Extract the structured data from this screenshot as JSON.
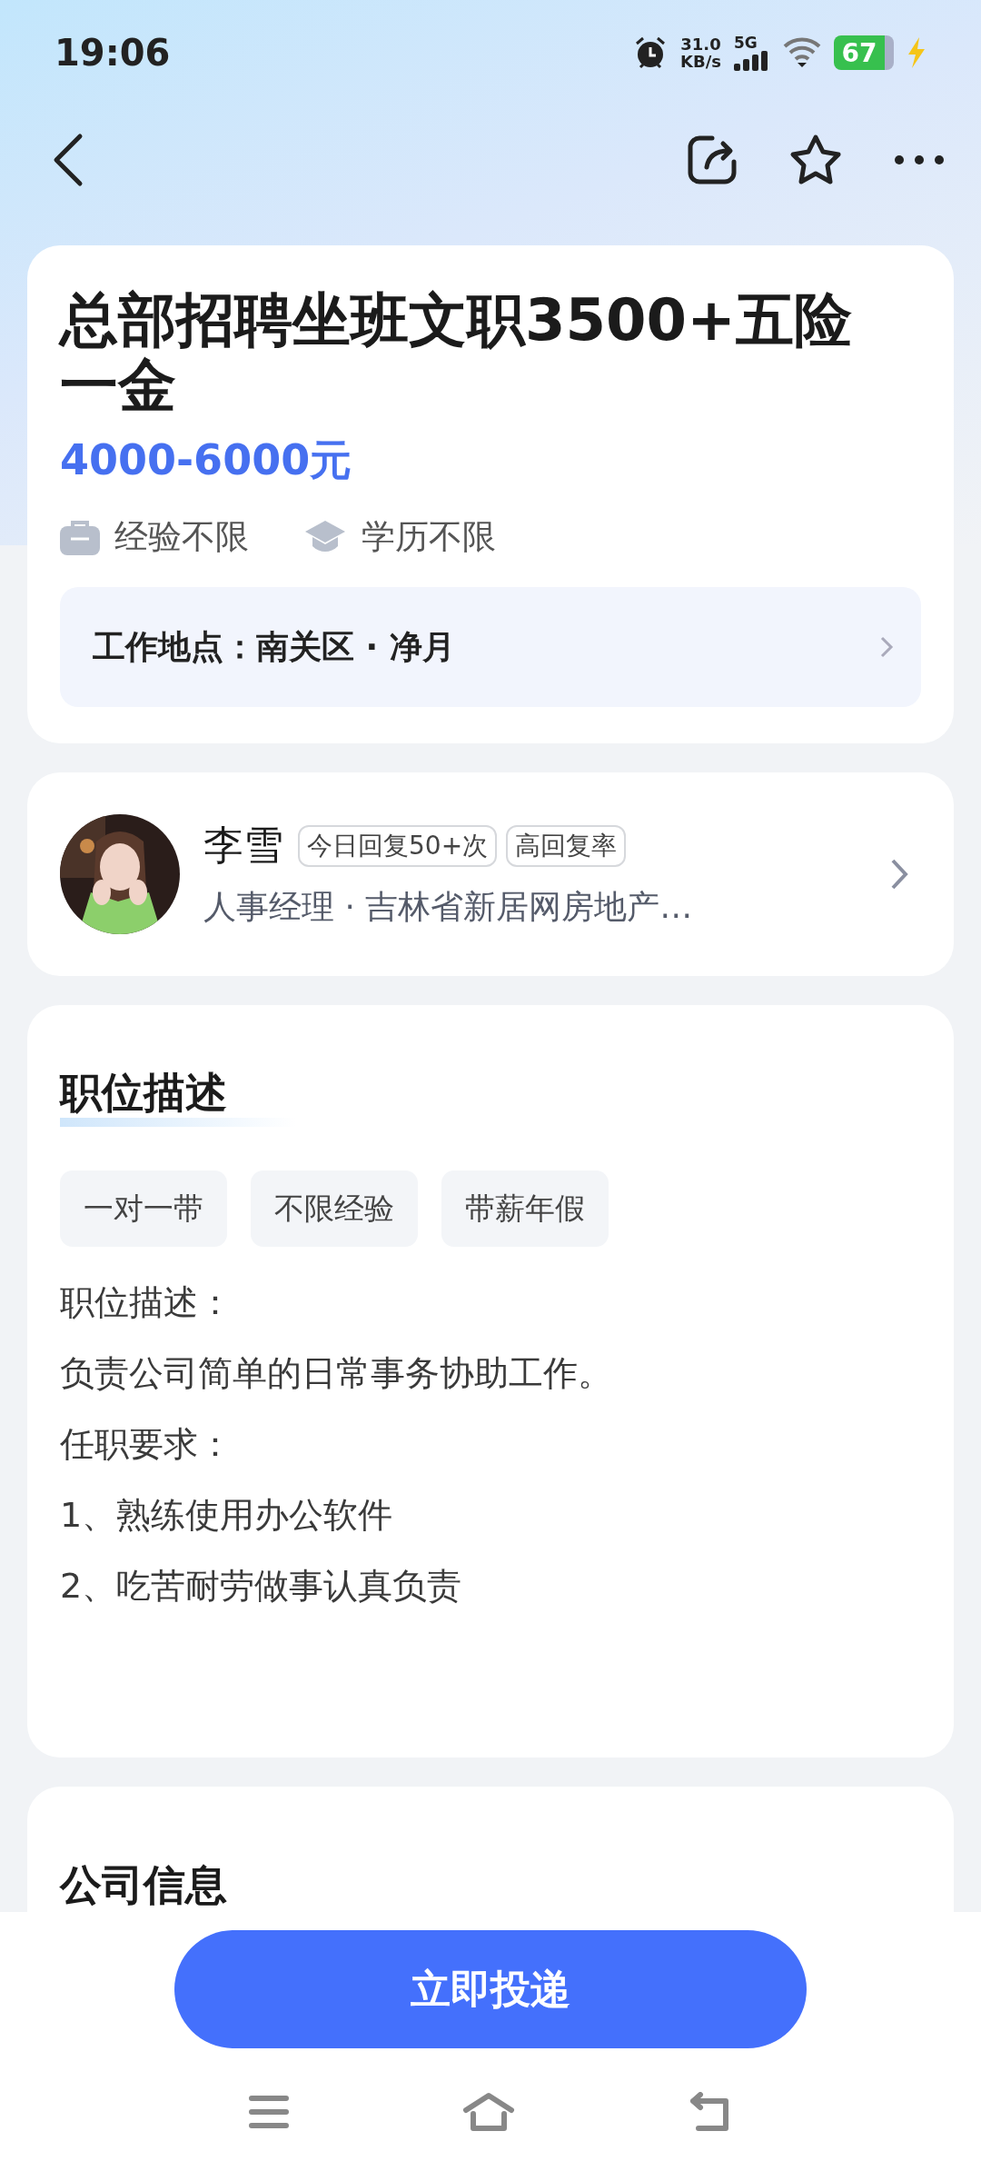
{
  "status_bar": {
    "time": "19:06",
    "net_speed": "31.0",
    "net_unit": "KB/s",
    "network": "5G",
    "battery": "67"
  },
  "job": {
    "title": "总部招聘坐班文职3500+五险一金",
    "salary": "4000-6000元",
    "requirements": [
      {
        "kind": "experience",
        "label": "经验不限"
      },
      {
        "kind": "education",
        "label": "学历不限"
      }
    ],
    "location": "工作地点：南关区 · 净月"
  },
  "recruiter": {
    "name": "李雪",
    "badges": [
      "今日回复50+次",
      "高回复率"
    ],
    "role": "人事经理 · 吉林省新居网房地产…"
  },
  "description": {
    "heading": "职位描述",
    "tags": [
      "一对一带",
      "不限经验",
      "带薪年假"
    ],
    "lines": [
      "职位描述：",
      "负责公司简单的日常事务协助工作。",
      "任职要求：",
      "1、熟练使用办公软件",
      "2、吃苦耐劳做事认真负责"
    ]
  },
  "company": {
    "heading": "公司信息"
  },
  "apply_button": "立即投递"
}
